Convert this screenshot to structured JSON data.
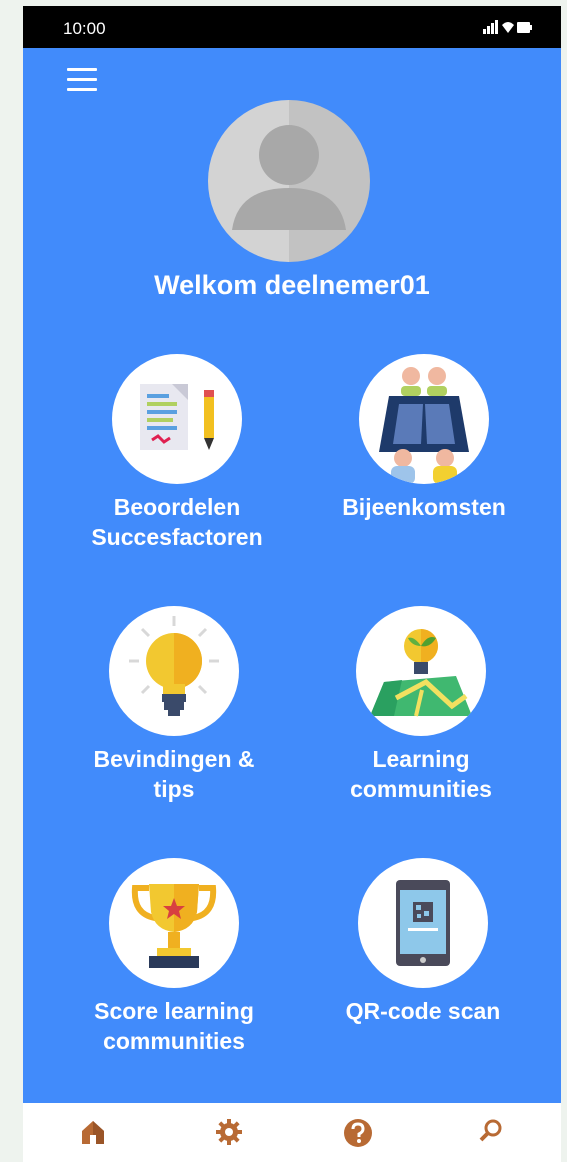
{
  "status_bar": {
    "time": "10:00"
  },
  "header": {
    "welcome_text": "Welkom deelnemer01"
  },
  "tiles": [
    {
      "label": "Beoordelen\nSuccesfactoren",
      "icon": "document-pencil-icon"
    },
    {
      "label": "Bijeenkomsten",
      "icon": "meeting-icon"
    },
    {
      "label": "Bevindingen &\ntips",
      "icon": "lightbulb-icon"
    },
    {
      "label": "Learning\ncommunities",
      "icon": "map-sprout-icon"
    },
    {
      "label": "Score learning\ncommunities",
      "icon": "trophy-icon"
    },
    {
      "label": "QR-code scan",
      "icon": "phone-qr-icon"
    }
  ],
  "bottom_nav": [
    {
      "icon": "home-icon"
    },
    {
      "icon": "gear-icon"
    },
    {
      "icon": "help-icon"
    },
    {
      "icon": "search-icon"
    }
  ],
  "colors": {
    "background": "#418bfb",
    "status_bar": "#000000",
    "nav_icon": "#b86a34"
  }
}
